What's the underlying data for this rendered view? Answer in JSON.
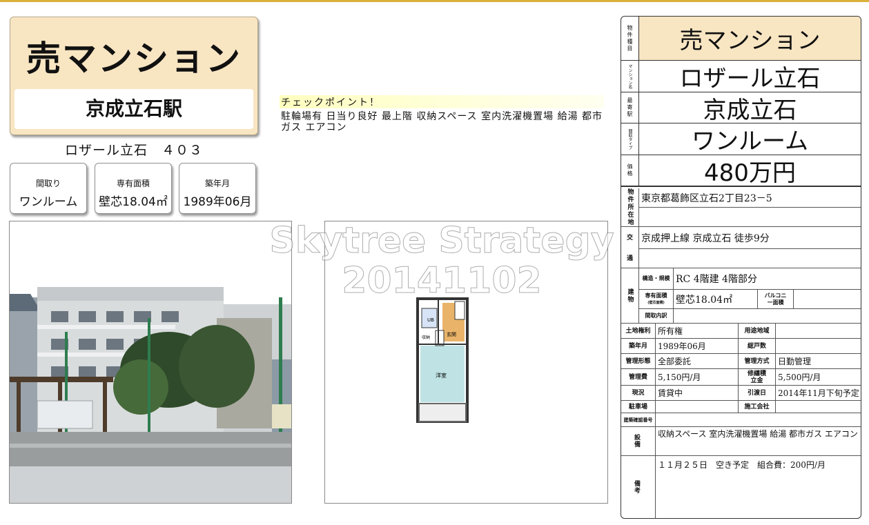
{
  "left": {
    "title": "売マンション",
    "station": "京成立石駅",
    "building_room": "ロザール立石　４０３",
    "boxes": [
      {
        "label": "間取り",
        "value": "ワンルーム"
      },
      {
        "label": "専有面積",
        "value": "壁芯18.04㎡"
      },
      {
        "label": "築年月",
        "value": "1989年06月"
      }
    ]
  },
  "watermark": {
    "line1": "Skytree Strategy",
    "line2": "20141102"
  },
  "checkpoint": {
    "title": "チェックポイント！",
    "text": "駐輪場有 日当り良好 最上階 収納スペース 室内洗濯機置場 給湯 都市ガス エアコン"
  },
  "floorplan": {
    "room_label": "洋室",
    "bath_label": "UB",
    "storage_label": "収納",
    "entry_label": "玄関"
  },
  "right": {
    "header": [
      {
        "label": "物件種目",
        "value": "売マンション"
      },
      {
        "label": "マンション名",
        "value": "ロザール立石"
      },
      {
        "label": "最寄駅",
        "value": "京成立石"
      },
      {
        "label": "間取タイプ",
        "value": "ワンルーム"
      },
      {
        "label": "価格",
        "value": "480万円"
      }
    ],
    "address_label": "物件所在地",
    "address": "東京都葛飾区立石2丁目23－5",
    "transport_label1": "交",
    "transport_label2": "通",
    "transport": "京成押上線 京成立石 徒歩9分",
    "building_label": "建物",
    "structure_label": "構造・規模",
    "structure": "RC 4階建 4階部分",
    "area_label": "専有面積",
    "area_sub": "(壁芯面積)",
    "area": "壁芯18.04㎡",
    "balcony_label": "バルコニー面積",
    "balcony": "",
    "layout_label": "間取内訳",
    "layout": "",
    "rows": [
      {
        "l1": "土地権利",
        "v1": "所有権",
        "l2": "用途地域",
        "v2": ""
      },
      {
        "l1": "築年月",
        "v1": "1989年06月",
        "l2": "総戸数",
        "v2": ""
      },
      {
        "l1": "管理形態",
        "v1": "全部委託",
        "l2": "管理方式",
        "v2": "日勤管理"
      },
      {
        "l1": "管理費",
        "v1": "5,150円/月",
        "l2": "修繕積立金",
        "v2": "5,500円/月"
      },
      {
        "l1": "現況",
        "v1": "賃貸中",
        "l2": "引渡日",
        "v2": "2014年11月下旬予定"
      },
      {
        "l1": "駐車場",
        "v1": "",
        "l2": "施工会社",
        "v2": ""
      }
    ],
    "permit_label": "建築確認番号",
    "permit": "",
    "facilities_label": "設備",
    "facilities": "収納スペース 室内洗濯機置場 給湯 都市ガス エアコン",
    "remarks_label": "備考",
    "remarks": "１１月２５日　空き予定　組合費：200円/月"
  },
  "colors": {
    "tan": "#f8e5c2",
    "gold_line": "#d9b13b"
  }
}
